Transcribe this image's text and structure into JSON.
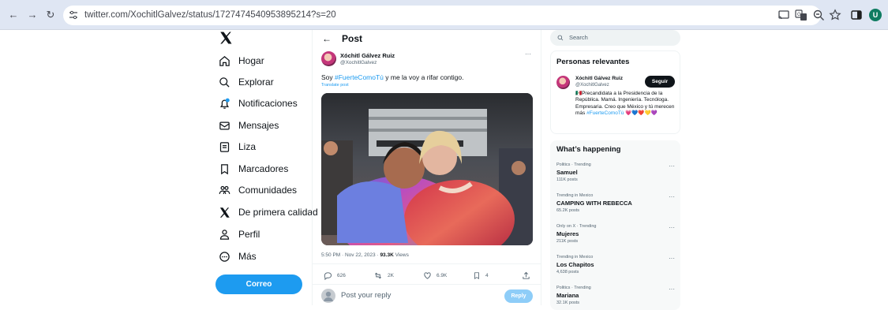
{
  "browser": {
    "url": "twitter.com/XochitlGalvez/status/1727474540953895214?s=20",
    "profile_initial": "U"
  },
  "sidebar": {
    "items": [
      {
        "label": "Hogar",
        "icon": "home-icon"
      },
      {
        "label": "Explorar",
        "icon": "search-icon"
      },
      {
        "label": "Notificaciones",
        "icon": "bell-icon"
      },
      {
        "label": "Mensajes",
        "icon": "mail-icon"
      },
      {
        "label": "Liza",
        "icon": "list-icon"
      },
      {
        "label": "Marcadores",
        "icon": "bookmark-icon"
      },
      {
        "label": "Comunidades",
        "icon": "communities-icon"
      },
      {
        "label": "De primera calidad",
        "icon": "x-icon"
      },
      {
        "label": "Perfil",
        "icon": "person-icon"
      },
      {
        "label": "Más",
        "icon": "more-circle-icon"
      }
    ],
    "post_button": "Correo"
  },
  "post": {
    "header": "Post",
    "author_name": "Xóchitl Gálvez Ruiz",
    "author_handle": "@XochitlGalvez",
    "text_prefix": "Soy ",
    "hashtag": "#FuerteComoTú",
    "text_suffix": " y me la voy a rifar contigo.",
    "translate": "Translate post",
    "time": "5:50 PM · Nov 22, 2023 · ",
    "views": "93.3K",
    "views_label": " Views",
    "replies": "626",
    "reposts": "2K",
    "likes": "6.9K",
    "bookmarks": "4",
    "reply_placeholder": "Post your reply",
    "reply_button": "Reply",
    "more": "···"
  },
  "right": {
    "search_placeholder": "Search",
    "relevant_title": "Personas relevantes",
    "relevant_name": "Xóchitl Gálvez Ruiz",
    "relevant_handle": "@XochitlGalvez",
    "follow_label": "Seguir",
    "bio": "🇲🇽Precandidata a la Presidencia de la República. Mamá. Ingeniería. Tecnóloga. Empresaria. Creo que México y tú merecen más",
    "bio_hashtag": "#FuerteComoTú",
    "bio_hearts": "💗💙❤️💛💜",
    "happening_title": "What’s happening",
    "trends": [
      {
        "meta": "Politics · Trending",
        "title": "Samuel",
        "count": "111K posts"
      },
      {
        "meta": "Trending in Mexico",
        "title": "CAMPING WITH REBECCA",
        "count": "65.2K posts"
      },
      {
        "meta": "Only on X · Trending",
        "title": "Mujeres",
        "count": "211K posts"
      },
      {
        "meta": "Trending in Mexico",
        "title": "Los Chapitos",
        "count": "4,638 posts"
      },
      {
        "meta": "Politics · Trending",
        "title": "Mariana",
        "count": "32.1K posts"
      }
    ]
  }
}
